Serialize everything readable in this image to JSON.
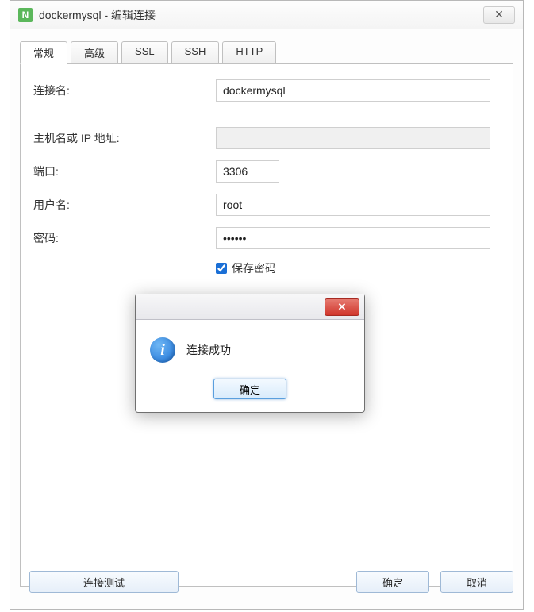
{
  "window": {
    "title": "dockermysql - 编辑连接",
    "app_icon_glyph": "N"
  },
  "tabs": [
    {
      "label": "常规"
    },
    {
      "label": "高级"
    },
    {
      "label": "SSL"
    },
    {
      "label": "SSH"
    },
    {
      "label": "HTTP"
    }
  ],
  "form": {
    "connection_name": {
      "label": "连接名:",
      "value": "dockermysql"
    },
    "host": {
      "label": "主机名或 IP 地址:",
      "value": ""
    },
    "port": {
      "label": "端口:",
      "value": "3306"
    },
    "username": {
      "label": "用户名:",
      "value": "root"
    },
    "password": {
      "label": "密码:",
      "value": "••••••"
    },
    "save_password": {
      "label": "保存密码",
      "checked": true
    }
  },
  "buttons": {
    "test_connection": "连接测试",
    "ok": "确定",
    "cancel": "取消"
  },
  "dialog": {
    "message": "连接成功",
    "ok": "确定"
  }
}
